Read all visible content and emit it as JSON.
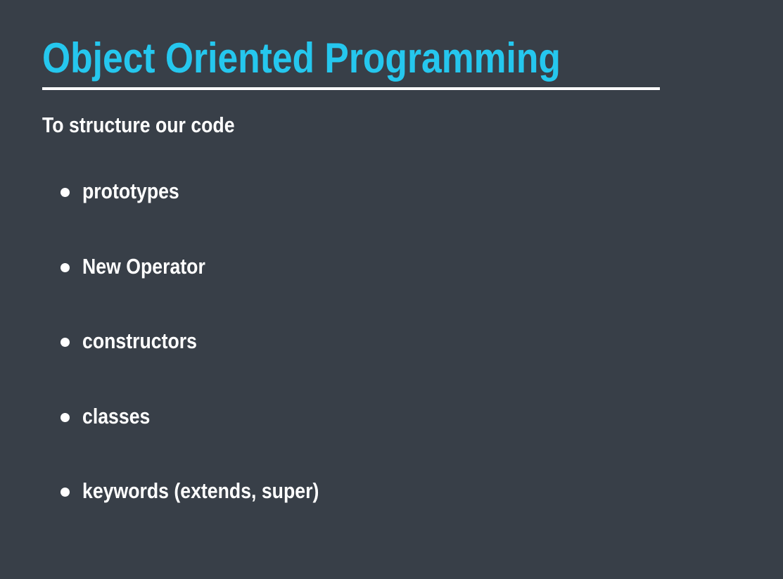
{
  "slide": {
    "title": "Object Oriented Programming",
    "subtitle": "To structure our code",
    "bullets": [
      "prototypes",
      "New Operator",
      "constructors",
      "classes",
      "keywords (extends, super)"
    ]
  },
  "colors": {
    "background": "#383f48",
    "title": "#25c7ee",
    "text": "#ffffff"
  }
}
